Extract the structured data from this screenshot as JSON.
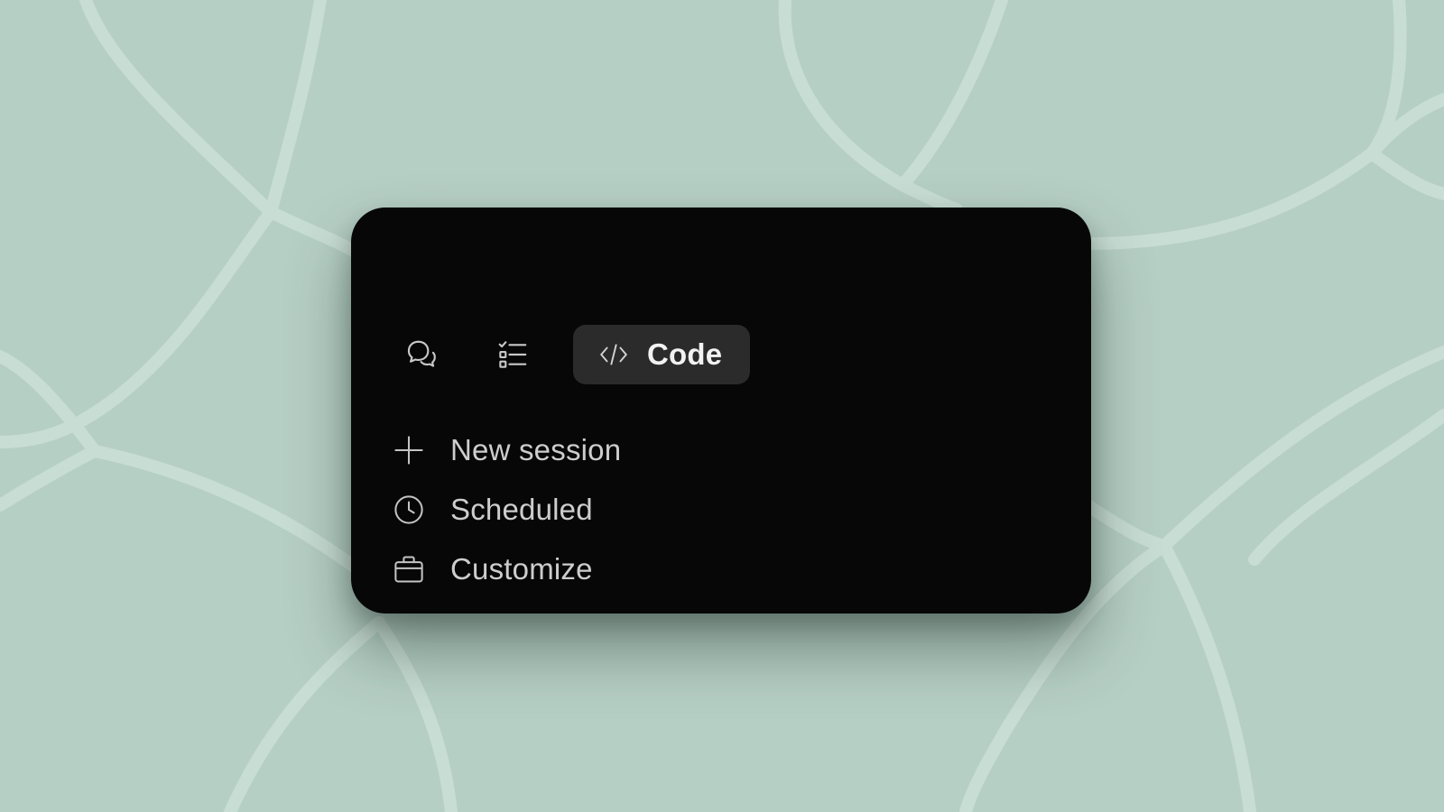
{
  "background": {
    "color": "#b6cfc5",
    "line_color": "#c8ddd4"
  },
  "panel": {
    "background": "#070707"
  },
  "tabs": [
    {
      "icon": "chat-bubbles-icon",
      "selected": false
    },
    {
      "icon": "checklist-icon",
      "selected": false
    },
    {
      "icon": "code-brackets-icon",
      "label": "Code",
      "selected": true
    }
  ],
  "menu": {
    "items": [
      {
        "icon": "plus-icon",
        "label": "New session"
      },
      {
        "icon": "clock-icon",
        "label": "Scheduled"
      },
      {
        "icon": "briefcase-icon",
        "label": "Customize"
      }
    ]
  }
}
